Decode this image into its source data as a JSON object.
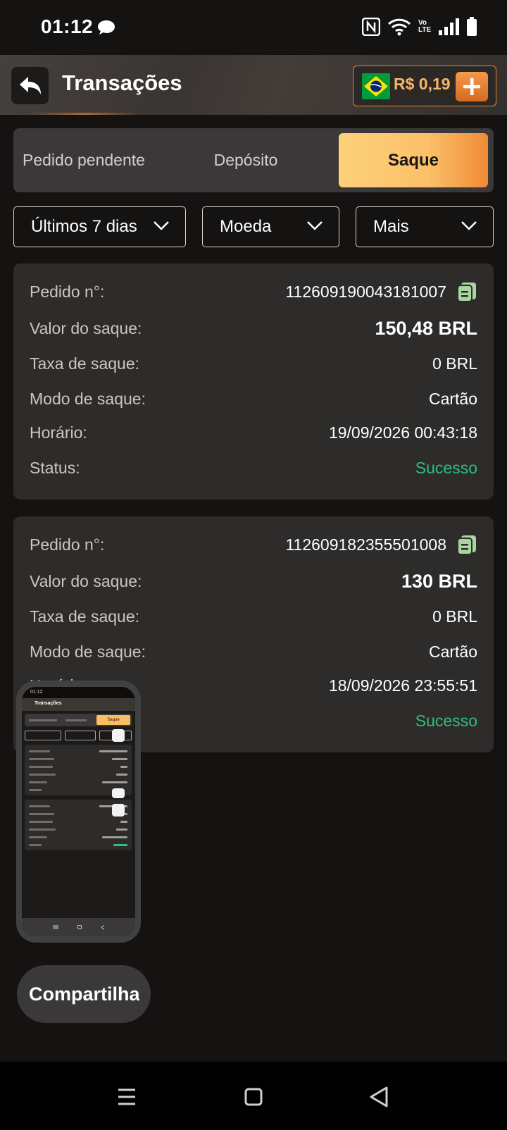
{
  "status_bar": {
    "time": "01:12",
    "icons": [
      "chat-bubble-icon",
      "nfc-icon",
      "wifi-icon",
      "volte-icon",
      "signal-icon",
      "battery-icon"
    ],
    "volte_label": "Vo LTE"
  },
  "header": {
    "title": "Transações",
    "balance": "R$ 0,19",
    "back_icon": "back-arrow-icon",
    "add_icon": "plus-icon",
    "flag_icon": "brazil-flag-icon"
  },
  "tabs": [
    {
      "label": "Pedido pendente",
      "selected": false
    },
    {
      "label": "Depósito",
      "selected": false
    },
    {
      "label": "Saque",
      "selected": true
    }
  ],
  "filters": [
    {
      "label": "Últimos 7 dias"
    },
    {
      "label": "Moeda"
    },
    {
      "label": "Mais"
    }
  ],
  "labels": {
    "order_no": "Pedido n°:",
    "amount": "Valor do saque:",
    "fee": "Taxa de saque:",
    "mode": "Modo de saque:",
    "time": "Horário:",
    "status": "Status:"
  },
  "transactions": [
    {
      "order_no": "112609190043181007",
      "amount": "150,48 BRL",
      "fee": "0 BRL",
      "mode": "Cartão",
      "time": "19/09/2026 00:43:18",
      "status": "Sucesso"
    },
    {
      "order_no": "112609182355501008",
      "amount": "130 BRL",
      "fee": "0 BRL",
      "mode": "Cartão",
      "time": "18/09/2026 23:55:51",
      "status": "Sucesso"
    }
  ],
  "preview": {
    "time": "01:12",
    "title": "Transações",
    "tab_selected": "Saque"
  },
  "share_button": {
    "label": "Compartilhar"
  },
  "nav_bar": {
    "icons": [
      "menu-icon",
      "home-square-icon",
      "back-triangle-icon"
    ]
  },
  "colors": {
    "accent_orange": "#f08a35",
    "accent_yellow": "#fdd07a",
    "success_green": "#2fbe7b",
    "card_bg": "#2e2c2b",
    "page_bg": "#151312"
  }
}
